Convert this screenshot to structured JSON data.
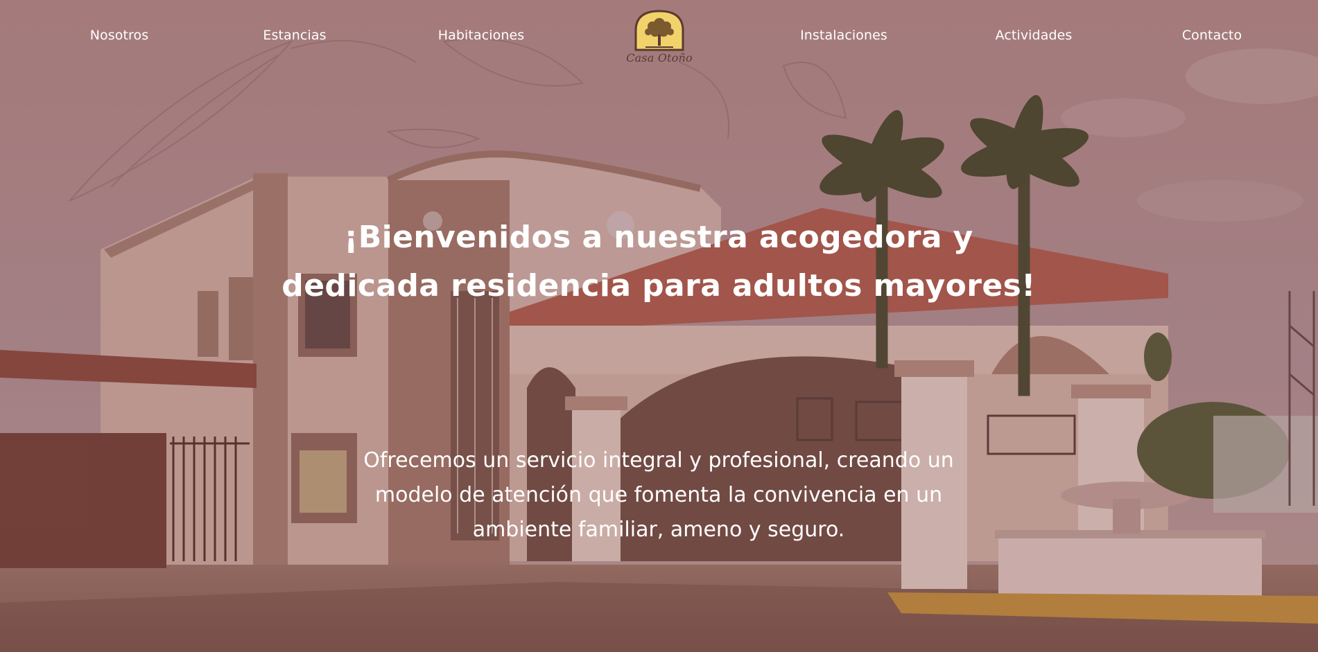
{
  "nav": {
    "items": [
      {
        "label": "Nosotros"
      },
      {
        "label": "Estancias"
      },
      {
        "label": "Habitaciones"
      },
      {
        "label": "Instalaciones"
      },
      {
        "label": "Actividades"
      },
      {
        "label": "Contacto"
      }
    ],
    "logo_text": "Casa Otoño",
    "logo_icon": "tree-icon"
  },
  "hero": {
    "headline_line1": "¡Bienvenidos a nuestra acogedora y",
    "headline_line2": "dedicada residencia para adultos mayores!",
    "subtext_line1": "Ofrecemos un servicio integral y profesional, creando un",
    "subtext_line2": "modelo de atención que fomenta la convivencia en un",
    "subtext_line3": "ambiente familiar, ameno y seguro."
  },
  "colors": {
    "overlay": "#7a403c",
    "logo_badge": "#f2d36b",
    "text": "#ffffff"
  }
}
